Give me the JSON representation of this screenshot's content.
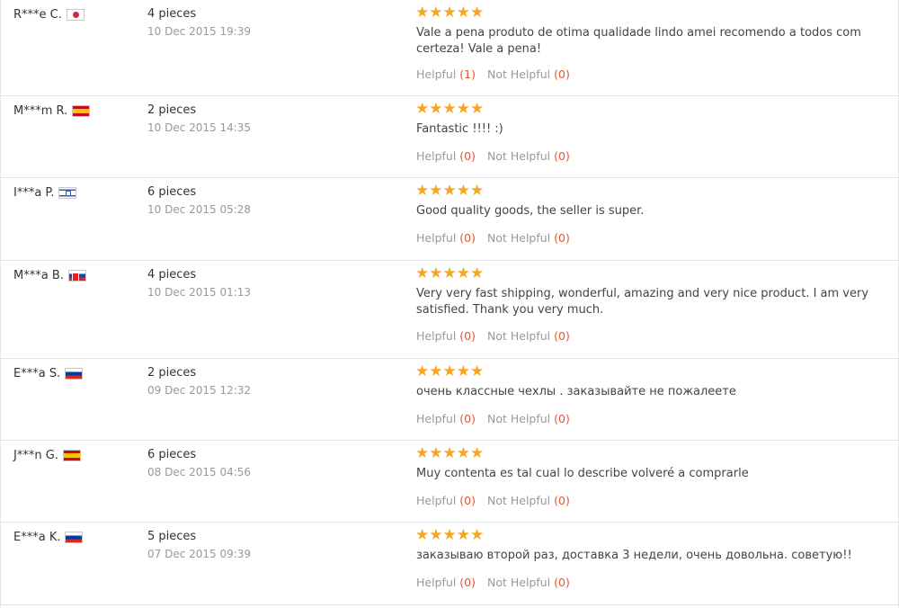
{
  "labels": {
    "helpful": "Helpful",
    "not_helpful": "Not Helpful"
  },
  "rating_stars": "★★★★★",
  "reviews": [
    {
      "buyer": "R***e C.",
      "flag": "flag-jp",
      "quantity": "4 pieces",
      "date": "10 Dec 2015 19:39",
      "text": "Vale a pena produto de otima qualidade lindo amei recomendo a todos com certeza! Vale a pena!",
      "helpful": "(1)",
      "not_helpful": "(0)",
      "rating": 5
    },
    {
      "buyer": "M***m R.",
      "flag": "flag-es",
      "quantity": "2 pieces",
      "date": "10 Dec 2015 14:35",
      "text": "Fantastic !!!! :)",
      "helpful": "(0)",
      "not_helpful": "(0)",
      "rating": 5
    },
    {
      "buyer": "I***a P.",
      "flag": "flag-il",
      "quantity": "6 pieces",
      "date": "10 Dec 2015 05:28",
      "text": "Good quality goods, the seller is super.",
      "helpful": "(0)",
      "not_helpful": "(0)",
      "rating": 5
    },
    {
      "buyer": "M***a B.",
      "flag": "flag-sk",
      "quantity": "4 pieces",
      "date": "10 Dec 2015 01:13",
      "text": "Very very fast shipping, wonderful, amazing and very nice product. I am very satisfied. Thank you very much.",
      "helpful": "(0)",
      "not_helpful": "(0)",
      "rating": 5
    },
    {
      "buyer": "E***a S.",
      "flag": "flag-ru",
      "quantity": "2 pieces",
      "date": "09 Dec 2015 12:32",
      "text": "очень классные чехлы . заказывайте не пожалеете",
      "helpful": "(0)",
      "not_helpful": "(0)",
      "rating": 5
    },
    {
      "buyer": "J***n G.",
      "flag": "flag-es",
      "quantity": "6 pieces",
      "date": "08 Dec 2015 04:56",
      "text": "Muy contenta es tal cual lo describe volveré a comprarle",
      "helpful": "(0)",
      "not_helpful": "(0)",
      "rating": 5
    },
    {
      "buyer": "E***a K.",
      "flag": "flag-ru",
      "quantity": "5 pieces",
      "date": "07 Dec 2015 09:39",
      "text": "заказываю второй раз, доставка 3 недели, очень довольна. советую!!",
      "helpful": "(0)",
      "not_helpful": "(0)",
      "rating": 5
    }
  ],
  "colors": {
    "star": "#f6a623",
    "vote_count": "#e8552f",
    "muted": "#999999",
    "divider": "#e2e2e2"
  }
}
